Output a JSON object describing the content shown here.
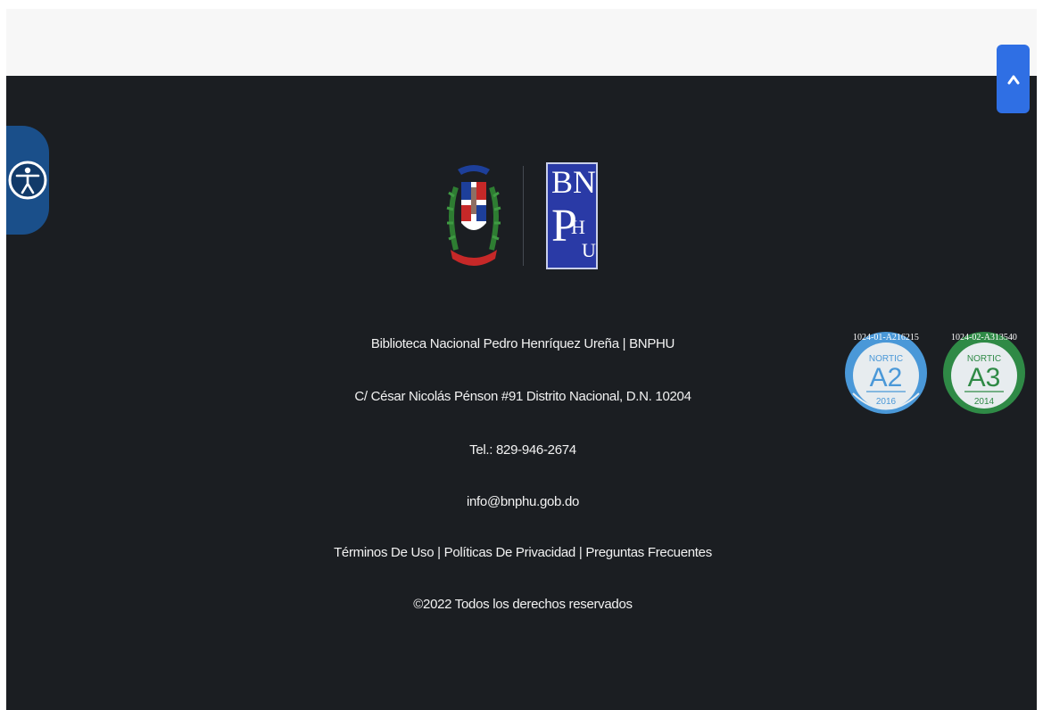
{
  "footer": {
    "org_name": "Biblioteca Nacional Pedro Henríquez Ureña | BNPHU",
    "address": "C/ César Nicolás Pénson #91 Distrito Nacional, D.N. 10204",
    "phone": "Tel.: 829-946-2674",
    "email": "info@bnphu.gob.do",
    "links": [
      {
        "label": "Términos De Uso"
      },
      {
        "label": "Políticas De Privacidad"
      },
      {
        "label": "Preguntas Frecuentes"
      }
    ],
    "separator": "|",
    "copyright": "©2022 Todos los derechos reservados"
  },
  "logos": {
    "bnphu_letters": [
      "B",
      "N",
      "P",
      "H",
      "U"
    ]
  },
  "seals": [
    {
      "code": "1024-01-A216215",
      "brand": "NORTIC",
      "level": "A2",
      "year": "2016",
      "color": "#4a98d8"
    },
    {
      "code": "1024-02-A313540",
      "brand": "NORTIC",
      "level": "A3",
      "year": "2014",
      "color": "#2f8a46"
    }
  ],
  "icons": {
    "scroll_top": "chevron-up-icon",
    "accessibility": "accessibility-icon"
  },
  "colors": {
    "footer_bg": "#1b1e22",
    "accent": "#2f6fe4"
  }
}
